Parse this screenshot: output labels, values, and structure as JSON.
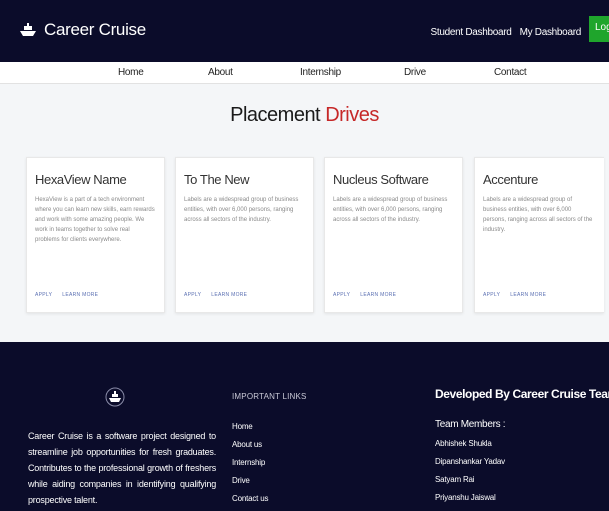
{
  "header": {
    "brand": "Career Cruise",
    "links": [
      "Student Dashboard",
      "My Dashboard"
    ],
    "login_label": "Login",
    "colors": {
      "bar": "#0b0c2a",
      "login": "#1fa52c"
    }
  },
  "nav": {
    "items": [
      "Home",
      "About",
      "Internship",
      "Drive",
      "Contact"
    ]
  },
  "main": {
    "title_prefix": "Placement",
    "title_accent": "Drives",
    "accent_color": "#c62828",
    "cards": [
      {
        "title": "HexaView Name",
        "text": "HexaView is a part of a tech environment where you can learn new skills, earn rewards and work with some amazing people. We work in teams together to solve real problems for clients everywhere.",
        "apply": "APPLY",
        "learn": "LEARN MORE"
      },
      {
        "title": "To The New",
        "text": "Labels are a widespread group of business entities, with over 6,000 persons, ranging across all sectors of the industry.",
        "apply": "APPLY",
        "learn": "LEARN MORE"
      },
      {
        "title": "Nucleus Software",
        "text": "Labels are a widespread group of business entities, with over 6,000 persons, ranging across all sectors of the industry.",
        "apply": "APPLY",
        "learn": "LEARN MORE"
      },
      {
        "title": "Accenture",
        "text": "Labels are a widespread group of business entities, with over 6,000 persons, ranging across all sectors of the industry.",
        "apply": "APPLY",
        "learn": "LEARN MORE"
      }
    ]
  },
  "footer": {
    "about": "Career Cruise is a software project designed to streamline job opportunities for fresh graduates. Contributes to the professional growth of freshers while aiding companies in identifying qualifying prospective talent.",
    "links_heading": "IMPORTANT LINKS",
    "links": [
      "Home",
      "About us",
      "Internship",
      "Drive",
      "Contact us"
    ],
    "dev_heading": "Developed By Career Cruise Team",
    "team_heading": "Team Members :",
    "team": [
      "Abhishek Shukla",
      "Dipanshankar Yadav",
      "Satyam Rai",
      "Priyanshu Jaiswal"
    ]
  }
}
